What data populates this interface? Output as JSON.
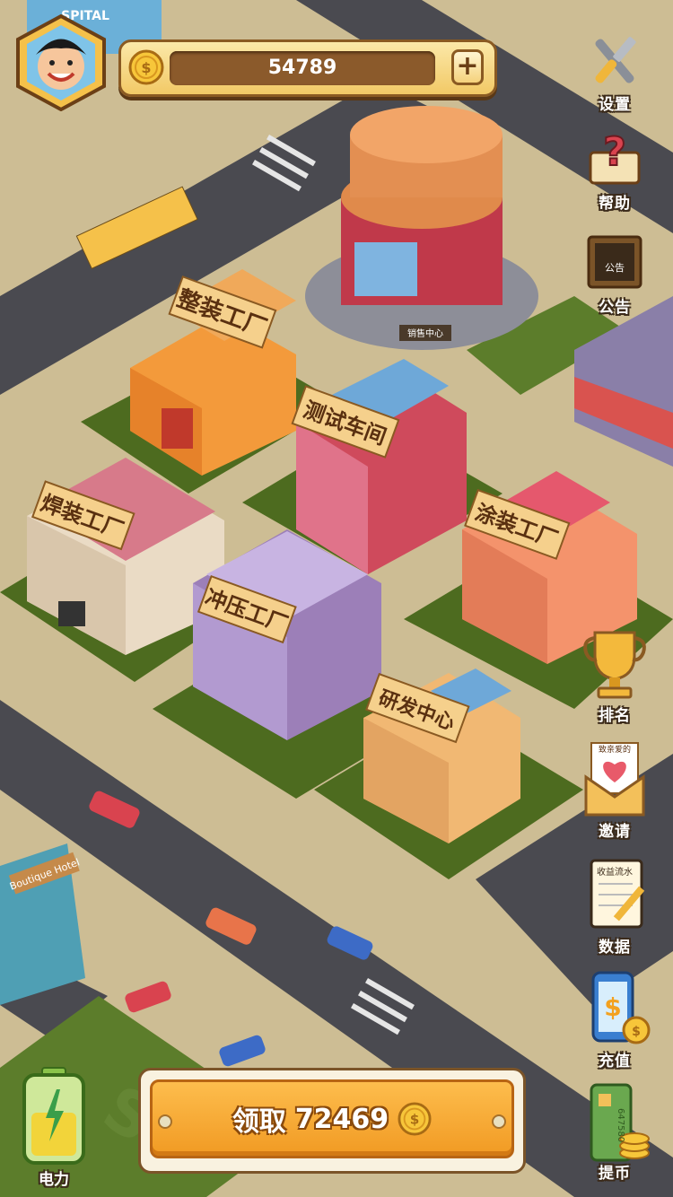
{
  "player": {
    "coins": "54789"
  },
  "side_menu": {
    "settings": "设置",
    "help": "帮助",
    "notice": "公告",
    "notice_sign": "公告",
    "ranking": "排名",
    "invite": "邀请",
    "invite_card": "致亲爱的",
    "data": "数据",
    "data_book": "收益流水",
    "recharge": "充值",
    "withdraw": "提币",
    "card_number": "647580"
  },
  "power": {
    "label": "电力"
  },
  "claim": {
    "label": "领取",
    "amount": "72469"
  },
  "buildings": {
    "assembly": "整装工厂",
    "testing": "测试车间",
    "welding": "焊装工厂",
    "painting": "涂装工厂",
    "stamping": "冲压工厂",
    "rnd": "研发中心",
    "sales_sign": "销售中心",
    "hospital": "SPITAL",
    "hotel": "Boutique Hotel"
  },
  "colors": {
    "ground": "#cdbd94",
    "road": "#4a4a50",
    "grass": "#5a7a2a",
    "accent_gold": "#f2c966",
    "claim_orange": "#f19a23"
  }
}
